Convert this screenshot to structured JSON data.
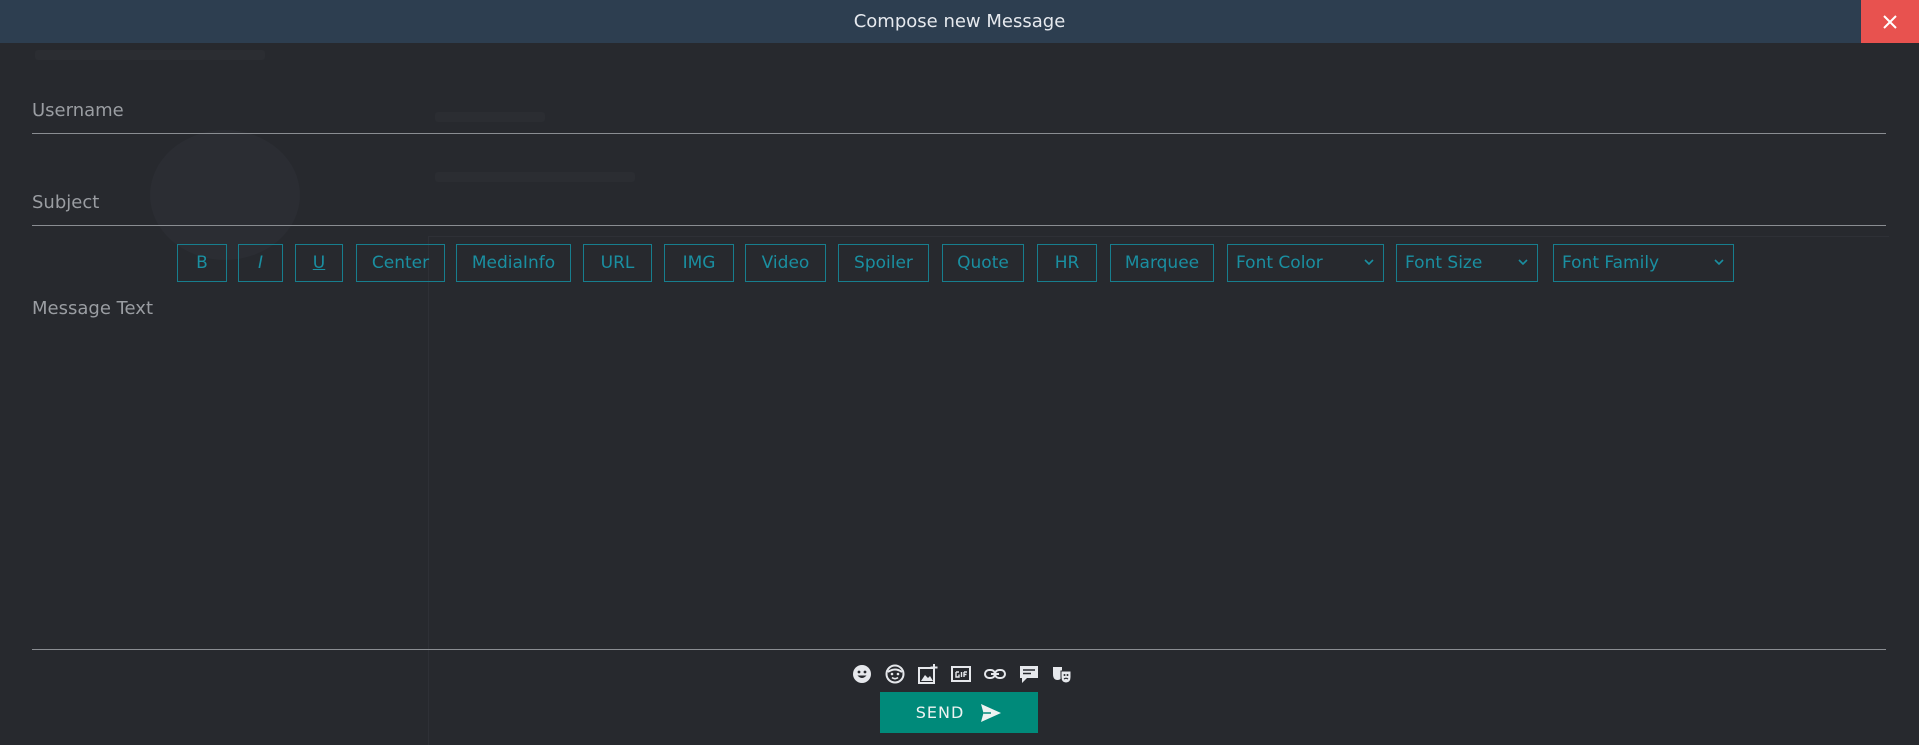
{
  "dialog": {
    "title": "Compose new Message"
  },
  "form": {
    "username_placeholder": "Username",
    "subject_placeholder": "Subject",
    "message_placeholder": "Message Text"
  },
  "toolbar": {
    "bold": "B",
    "italic": "I",
    "underline": "U",
    "center": "Center",
    "mediainfo": "MediaInfo",
    "url": "URL",
    "img": "IMG",
    "video": "Video",
    "spoiler": "Spoiler",
    "quote": "Quote",
    "hr": "HR",
    "marquee": "Marquee",
    "font_color": "Font Color",
    "font_size": "Font Size",
    "font_family": "Font Family"
  },
  "send": {
    "label": "SEND"
  },
  "colors": {
    "titlebar": "#2d3e50",
    "close": "#e8524f",
    "accent": "#1a8fa1",
    "send": "#008a7a"
  },
  "icons": [
    "emoji-icon",
    "smiley-icon",
    "add-image-icon",
    "gif-icon",
    "link-icon",
    "comment-icon",
    "masks-icon"
  ]
}
